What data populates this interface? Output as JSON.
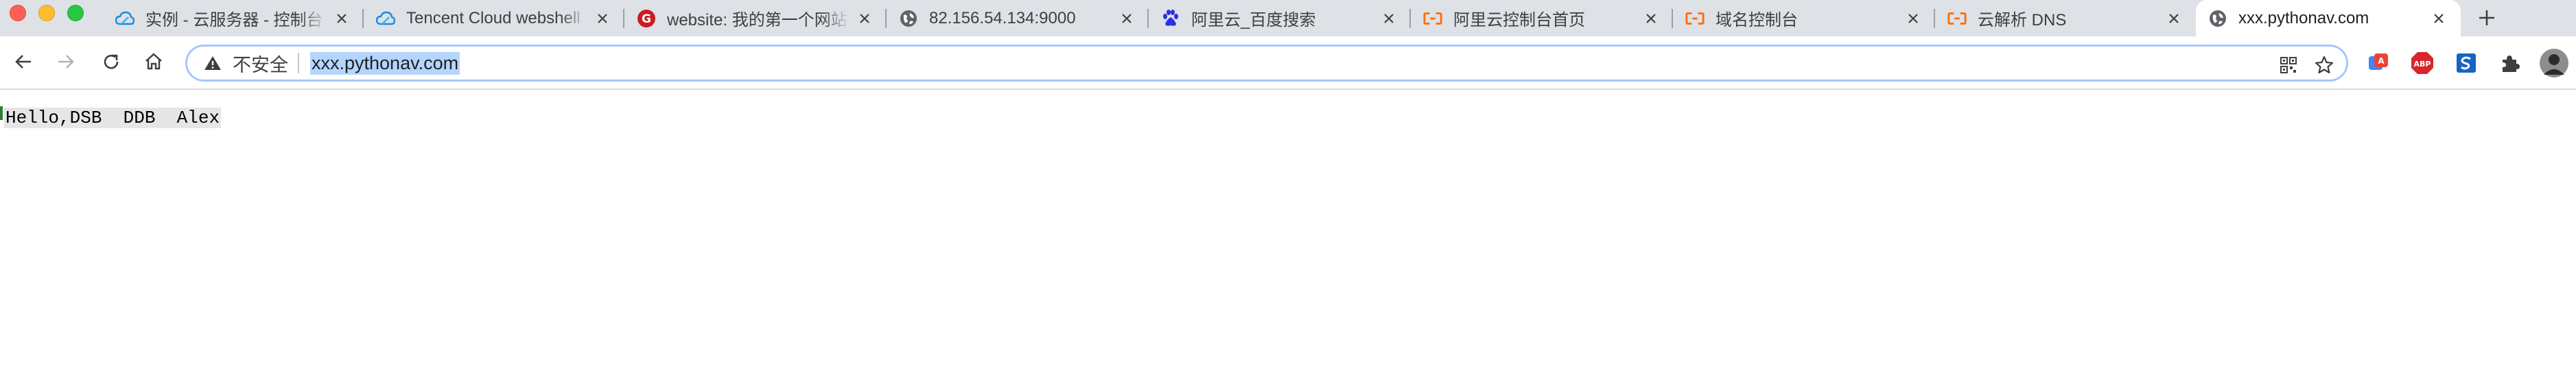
{
  "window": {
    "traffic_lights": [
      "close",
      "minimize",
      "zoom"
    ]
  },
  "tabs": [
    {
      "title": "实例 - 云服务器 - 控制台",
      "icon": "cloud-icon",
      "active": false
    },
    {
      "title": "Tencent Cloud webshell",
      "icon": "cloud-icon",
      "active": false
    },
    {
      "title": "website: 我的第一个网站",
      "icon": "gitee-icon",
      "active": false
    },
    {
      "title": "82.156.54.134:9000",
      "icon": "globe-icon",
      "active": false
    },
    {
      "title": "阿里云_百度搜索",
      "icon": "baidu-icon",
      "active": false
    },
    {
      "title": "阿里云控制台首页",
      "icon": "aliyun-icon",
      "active": false
    },
    {
      "title": "域名控制台",
      "icon": "aliyun-icon",
      "active": false
    },
    {
      "title": "云解析 DNS",
      "icon": "aliyun-icon",
      "active": false
    },
    {
      "title": "xxx.pythonav.com",
      "icon": "globe-icon",
      "active": true
    }
  ],
  "toolbar": {
    "security_label": "不安全",
    "url": "xxx.pythonav.com"
  },
  "page": {
    "text": "Hello,DSB  DDB  Alex"
  },
  "colors": {
    "tabstrip_bg": "#dee1e6",
    "omnibox_focus": "#a8c7fa",
    "url_selection": "#b4d5fe",
    "aliyun_orange": "#ff6a00",
    "tencent_blue": "#1e88e5",
    "gitee_red": "#c71d23",
    "baidu_blue": "#2932e1",
    "abp_red": "#d9262c"
  }
}
